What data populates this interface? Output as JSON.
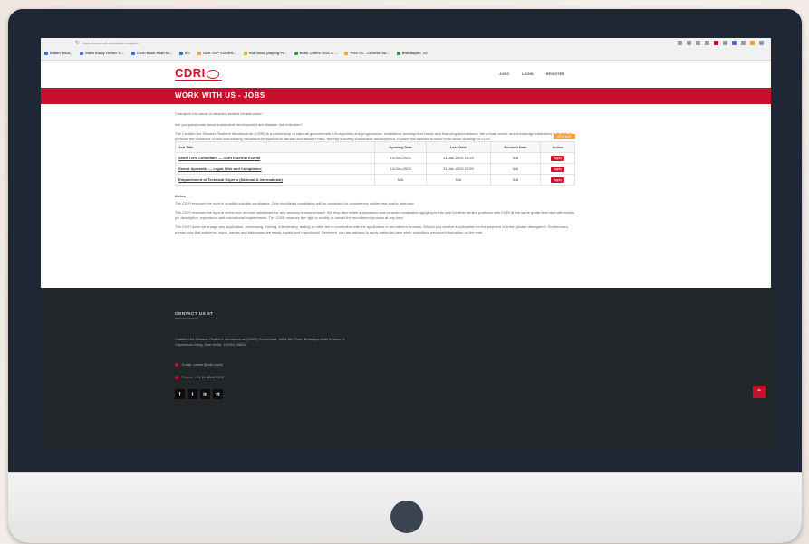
{
  "browser": {
    "url": "https://www.cdri.world/careers/jobs",
    "bookmarks": [
      "Indian Rout...",
      "India Study Online N...",
      "CDRI Bank Rout fu...",
      "Art",
      "OUR TOP COURS...",
      "Hub boat, playing Pr...",
      "Bank Coffee 2021 & ...",
      "Free CV - Curious ou...",
      "Brandapter_v2"
    ]
  },
  "header": {
    "logo": "CDRI",
    "nav": [
      "JOBS",
      "LOGIN",
      "REGISTER"
    ]
  },
  "page": {
    "title": "WORK WITH US - JOBS",
    "intro_1": "Champion the cause of disaster resilient infrastructure!",
    "intro_2": "Are you passionate about sustainable development and disaster risk reduction?",
    "intro_3": "The Coalition for Disaster Resilient Infrastructure (CDRI) is a partnership of national governments, UN agencies and programmes, multilateral development banks and financing mechanisms, the private sector, and knowledge institutions that aims to promote the resilience of new and existing infrastructure systems to climate and disaster risks, thereby ensuring sustainable development. Explore this website to learn more about working for CDRI.",
    "archive_label": "ARCHIVE"
  },
  "table": {
    "headers": [
      "Job Title",
      "Opening Date",
      "Last Date",
      "Revised Date",
      "Action"
    ],
    "rows": [
      {
        "title": "Short Term Consultant — CDRI External Events",
        "opening": "14-Dec-2023",
        "last": "31-Jan-2024 23:59",
        "revised": "N/A",
        "action": "Apply"
      },
      {
        "title": "Senior Specialist — Legal, Risk and Compliance",
        "opening": "14-Dec-2023",
        "last": "31-Jan-2024 23:59",
        "revised": "N/A",
        "action": "Apply"
      },
      {
        "title": "Empanelment of Technical Experts (National & International)",
        "opening": "N/A",
        "last": "N/A",
        "revised": "N/A",
        "action": "Apply"
      }
    ]
  },
  "notice": {
    "heading": "Notice",
    "line_1": "The CDRI reserves the right to shortlist suitable candidates. Only shortlisted candidates will be contacted for competency written test and/or interview.",
    "line_2": "The CDRI reserves the right to select one or more candidates for any vacancy announcement. We may also retain applications and consider candidates applying to this post for other similar positions with CDRI at the same grade level and with similar job description, experience and educational requirements. The CDRI reserves the right to modify or cancel the recruitment process at any time.",
    "line_3": "The CDRI does not charge any application, processing, training, interviewing, testing or other fee in connection with the application or recruitment process. Should you receive a solicitation for the payment of a fee, please disregard it. Furthermore, please note that emblems, logos, names and addresses are easily copied and reproduced. Therefore, you are advised to apply particular care when submitting personal information on the web."
  },
  "footer": {
    "heading": "CONTACT US AT",
    "address_1": "Coalition for Disaster Resilient Infrastructure (CDRI) Secretariat, 4th & 5th Floor, Bharatiya Kala Kendra, 1,",
    "address_2": "Copernicus Marg, New Delhi, 110001, INDIA",
    "email": "Email: career@cdri.world",
    "phone": "Phone: +91 11 4044 5999",
    "social": [
      "f",
      "t",
      "in",
      "yt"
    ]
  },
  "colors": {
    "brand_red": "#c8102e",
    "footer_bg": "#232629",
    "bezel": "#1e2733",
    "archive_orange": "#f0a33a"
  }
}
